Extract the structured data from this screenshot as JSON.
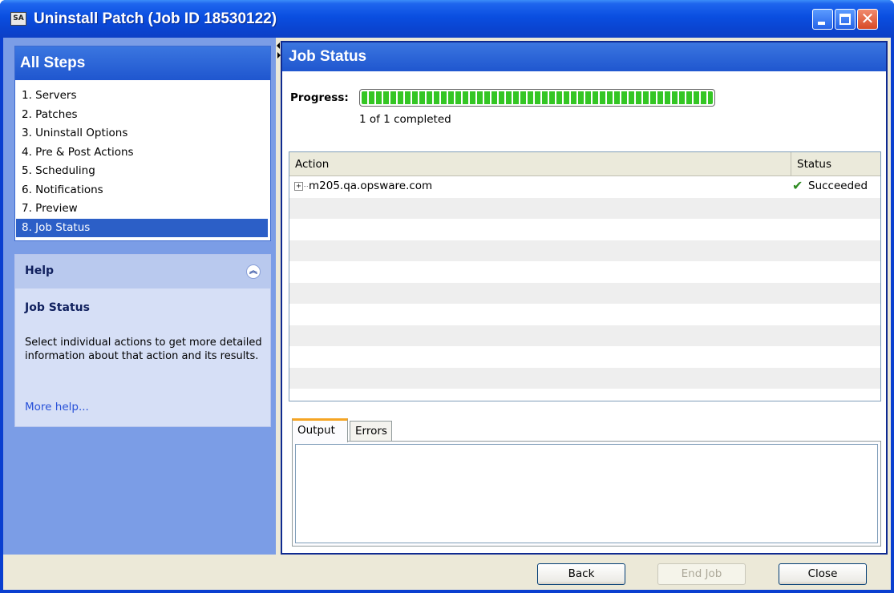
{
  "window": {
    "title": "Uninstall Patch (Job ID 18530122)",
    "icon_text": "SA"
  },
  "sidebar": {
    "title": "All Steps",
    "steps": [
      {
        "label": "1. Servers"
      },
      {
        "label": "2. Patches"
      },
      {
        "label": "3. Uninstall Options"
      },
      {
        "label": "4. Pre & Post Actions"
      },
      {
        "label": "5. Scheduling"
      },
      {
        "label": "6. Notifications"
      },
      {
        "label": "7. Preview"
      },
      {
        "label": "8. Job Status",
        "selected": true
      }
    ]
  },
  "help": {
    "header": "Help",
    "title": "Job Status",
    "text": "Select individual actions to get more detailed information about that action and its results.",
    "link": "More help..."
  },
  "main": {
    "title": "Job Status",
    "progress": {
      "label": "Progress:",
      "fraction": 1.0,
      "text": "1 of 1 completed"
    },
    "table": {
      "columns": [
        "Action",
        "Status"
      ],
      "rows": [
        {
          "action": "m205.qa.opsware.com",
          "status": "Succeeded",
          "status_icon": "check-icon"
        }
      ]
    },
    "tabs": [
      {
        "label": "Output",
        "active": true
      },
      {
        "label": "Errors",
        "active": false
      }
    ]
  },
  "footer": {
    "back_label": "Back",
    "end_job_label": "End Job",
    "close_label": "Close"
  },
  "colors": {
    "titlebar": "#0a4ee0",
    "accent": "#2c5fc7",
    "progress_fill": "#34c624",
    "success": "#2e8b22",
    "tab_highlight": "#f5a524"
  }
}
